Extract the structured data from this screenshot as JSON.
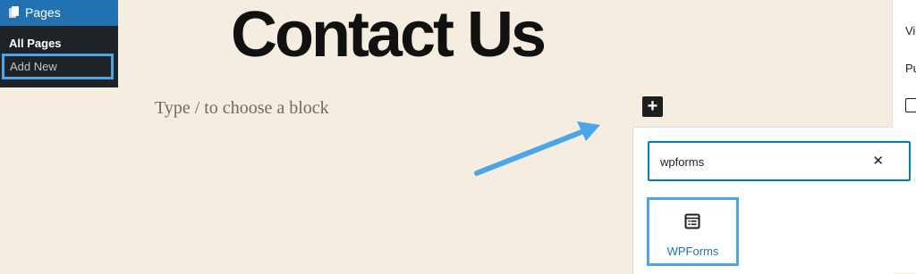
{
  "admin_menu": {
    "pages_label": "Pages",
    "submenu": {
      "all_pages": "All Pages",
      "add_new": "Add New"
    }
  },
  "editor": {
    "title": "Contact Us",
    "placeholder": "Type / to choose a block",
    "inserter_toggle_symbol": "+"
  },
  "settings_sidebar": {
    "label_1": "Vi",
    "label_2": "Pu"
  },
  "inserter": {
    "search_value": "wpforms",
    "clear_symbol": "✕",
    "results": [
      {
        "label": "WPForms",
        "icon": "wpforms-form-icon"
      }
    ]
  },
  "colors": {
    "admin_accent": "#2271b1",
    "highlight": "#4aa6e8",
    "canvas_bg": "#f5eee0",
    "admin_bg": "#1e2327"
  }
}
